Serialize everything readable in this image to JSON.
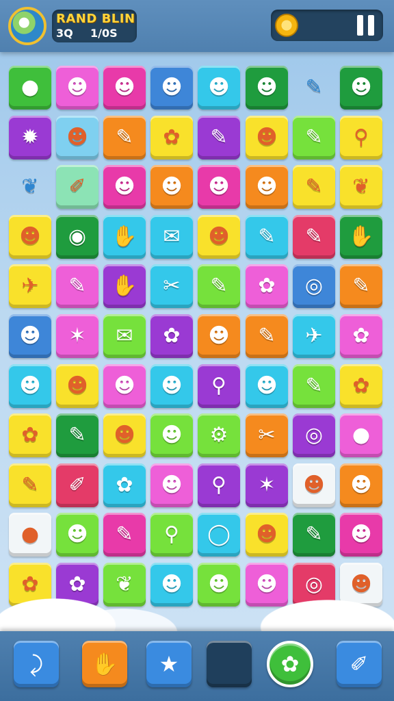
{
  "header": {
    "title": "RAND BLIN",
    "stat_left": "3Q",
    "stat_right": "1/0S"
  },
  "icons": {
    "avatar": "globe-avatar-icon",
    "coin": "coin-icon",
    "pause": "pause-icon"
  },
  "colors": {
    "G": "#3fbf3b",
    "P": "#ee5fd8",
    "M": "#e83aa9",
    "B": "#3e86d8",
    "C": "#34c8ea",
    "Y": "#f9e12b",
    "O": "#f58a1e",
    "V": "#9a3ad3",
    "L": "#76e13c",
    "R": "#e43b68",
    "T": "#8ce3b5",
    "W": "#f2f6f8",
    "K": "#1f9c3e",
    "S": "#7fd0f0"
  },
  "board": [
    [
      "G",
      "P",
      "M",
      "B",
      "C",
      "K",
      "",
      "K"
    ],
    [
      "V",
      "S",
      "O",
      "Y",
      "V",
      "Y",
      "L",
      "Y"
    ],
    [
      "",
      "T",
      "M",
      "O",
      "M",
      "O",
      "Y",
      "Y"
    ],
    [
      "Y",
      "K",
      "C",
      "C",
      "Y",
      "C",
      "R",
      "K"
    ],
    [
      "Y",
      "P",
      "V",
      "C",
      "L",
      "P",
      "B",
      "O"
    ],
    [
      "B",
      "P",
      "L",
      "V",
      "O",
      "O",
      "C",
      "P"
    ],
    [
      "C",
      "Y",
      "P",
      "C",
      "V",
      "C",
      "L",
      "Y"
    ],
    [
      "Y",
      "K",
      "Y",
      "L",
      "L",
      "O",
      "V",
      "P"
    ],
    [
      "Y",
      "R",
      "C",
      "P",
      "V",
      "V",
      "W",
      "O"
    ],
    [
      "W",
      "L",
      "M",
      "L",
      "C",
      "Y",
      "K",
      "M"
    ],
    [
      "Y",
      "V",
      "L",
      "C",
      "L",
      "P",
      "R",
      "W"
    ]
  ],
  "glyphs": [
    [
      "●",
      "☻",
      "☻",
      "☻",
      "☻",
      "☻",
      "✎",
      "☻"
    ],
    [
      "✹",
      "☻",
      "✎",
      "✿",
      "✎",
      "☻",
      "✎",
      "⚲"
    ],
    [
      "❦",
      "✐",
      "☻",
      "☻",
      "☻",
      "☻",
      "✎",
      "❦"
    ],
    [
      "☻",
      "◉",
      "✋",
      "✉",
      "☻",
      "✎",
      "✎",
      "✋"
    ],
    [
      "✈",
      "✎",
      "✋",
      "✂",
      "✎",
      "✿",
      "◎",
      "✎"
    ],
    [
      "☻",
      "✶",
      "✉",
      "✿",
      "☻",
      "✎",
      "✈",
      "✿"
    ],
    [
      "☻",
      "☻",
      "☻",
      "☻",
      "⚲",
      "☻",
      "✎",
      "✿"
    ],
    [
      "✿",
      "✎",
      "☻",
      "☻",
      "⚙",
      "✂",
      "◎",
      "●"
    ],
    [
      "✎",
      "✐",
      "✿",
      "☻",
      "⚲",
      "✶",
      "☻",
      "☻"
    ],
    [
      "●",
      "☻",
      "✎",
      "⚲",
      "◯",
      "☻",
      "✎",
      "☻"
    ],
    [
      "✿",
      "✿",
      "❦",
      "☻",
      "☻",
      "☻",
      "◎",
      "☻"
    ]
  ],
  "footer": [
    {
      "name": "swap-button",
      "icon": "swap-icon",
      "glyph": "⤸",
      "color": "#3a8be0"
    },
    {
      "name": "hammer-button",
      "icon": "hand-icon",
      "glyph": "✋",
      "color": "#f58a1e"
    },
    {
      "name": "star-button",
      "icon": "star-icon",
      "glyph": "★",
      "color": "#3a8be0"
    },
    {
      "name": "empty-slot",
      "icon": "empty-slot-icon",
      "glyph": "",
      "color": "#1f3f5c"
    },
    {
      "name": "flower-button",
      "icon": "flower-icon",
      "glyph": "✿",
      "color": "#3fbf3b",
      "round": true
    },
    {
      "name": "magic-button",
      "icon": "wand-icon",
      "glyph": "✐",
      "color": "#3a8be0"
    }
  ]
}
